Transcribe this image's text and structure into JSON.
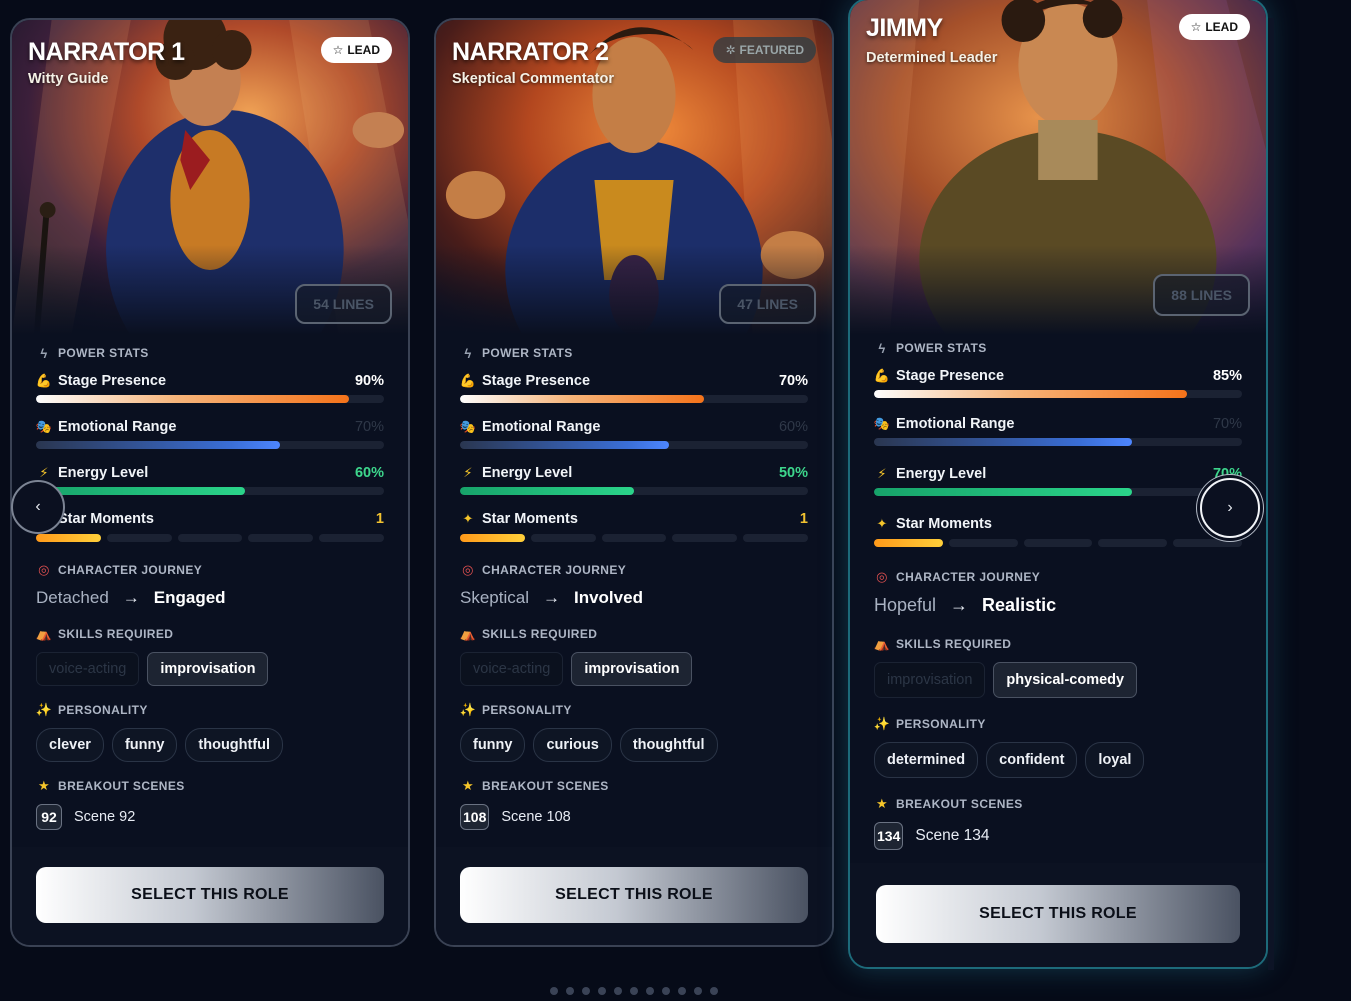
{
  "cards": [
    {
      "name": "NARRATOR 1",
      "subtitle": "Witty Guide",
      "badge": "LEAD",
      "lines": "54 LINES",
      "power_stats_title": "POWER STATS",
      "stats": {
        "stage": {
          "label": "Stage Presence",
          "value": "90%",
          "fill": 0.9
        },
        "emotional": {
          "label": "Emotional Range",
          "value": "70%",
          "fill": 0.7
        },
        "energy": {
          "label": "Energy Level",
          "value": "60%",
          "fill": 0.6
        },
        "star": {
          "label": "Star Moments",
          "value": "1",
          "segments_on": 1,
          "segments_total": 5
        }
      },
      "journey_title": "CHARACTER JOURNEY",
      "journey_from": "Detached",
      "journey_to": "Engaged",
      "skills_title": "SKILLS REQUIRED",
      "skills": [
        "voice-acting",
        "improvisation"
      ],
      "personality_title": "PERSONALITY",
      "personality": [
        "clever",
        "funny",
        "thoughtful"
      ],
      "breakout_title": "BREAKOUT SCENES",
      "scene_num": "92",
      "scene_label": "Scene 92",
      "select_label": "SELECT THIS ROLE"
    },
    {
      "name": "NARRATOR 2",
      "subtitle": "Skeptical Commentator",
      "badge": "FEATURED",
      "lines": "47 LINES",
      "power_stats_title": "POWER STATS",
      "stats": {
        "stage": {
          "label": "Stage Presence",
          "value": "70%",
          "fill": 0.7
        },
        "emotional": {
          "label": "Emotional Range",
          "value": "60%",
          "fill": 0.6
        },
        "energy": {
          "label": "Energy Level",
          "value": "50%",
          "fill": 0.5
        },
        "star": {
          "label": "Star Moments",
          "value": "1",
          "segments_on": 1,
          "segments_total": 5
        }
      },
      "journey_title": "CHARACTER JOURNEY",
      "journey_from": "Skeptical",
      "journey_to": "Involved",
      "skills_title": "SKILLS REQUIRED",
      "skills": [
        "voice-acting",
        "improvisation"
      ],
      "personality_title": "PERSONALITY",
      "personality": [
        "funny",
        "curious",
        "thoughtful"
      ],
      "breakout_title": "BREAKOUT SCENES",
      "scene_num": "108",
      "scene_label": "Scene 108",
      "select_label": "SELECT THIS ROLE"
    },
    {
      "name": "JIMMY",
      "subtitle": "Determined Leader",
      "badge": "LEAD",
      "lines": "88 LINES",
      "power_stats_title": "POWER STATS",
      "stats": {
        "stage": {
          "label": "Stage Presence",
          "value": "85%",
          "fill": 0.85
        },
        "emotional": {
          "label": "Emotional Range",
          "value": "70%",
          "fill": 0.7
        },
        "energy": {
          "label": "Energy Level",
          "value": "70%",
          "fill": 0.7
        },
        "star": {
          "label": "Star Moments",
          "value": "",
          "segments_on": 1,
          "segments_total": 5
        }
      },
      "journey_title": "CHARACTER JOURNEY",
      "journey_from": "Hopeful",
      "journey_to": "Realistic",
      "skills_title": "SKILLS REQUIRED",
      "skills": [
        "improvisation",
        "physical-comedy"
      ],
      "personality_title": "PERSONALITY",
      "personality": [
        "determined",
        "confident",
        "loyal"
      ],
      "breakout_title": "BREAKOUT SCENES",
      "scene_num": "134",
      "scene_label": "Scene 134",
      "select_label": "SELECT THIS ROLE"
    }
  ],
  "carousel": {
    "prev_icon": "‹",
    "next_icon": "›",
    "dot_count": 11
  },
  "colors": {
    "stat_value_green": "#3dd68c",
    "stat_value_gold": "#f2c230",
    "emotional_value_muted": "#2f3848",
    "card_border_active": "#1d6a7a"
  }
}
